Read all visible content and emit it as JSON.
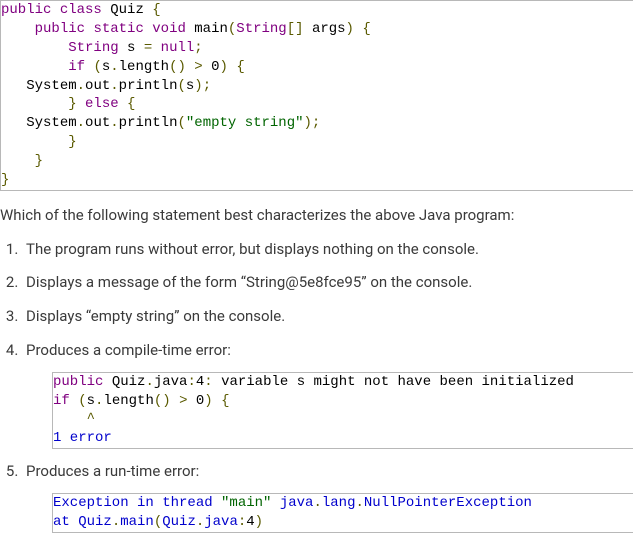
{
  "code_main": {
    "l1": "public class Quiz {",
    "l2": "    public static void main(String[] args) {",
    "l3": "        String s = null;",
    "l4": "        if (s.length() > 0) {",
    "l5": "   System.out.println(s);",
    "l6": "        } else {",
    "l7": "   System.out.println(\"empty string\");",
    "l8": "        }",
    "l9": "    }",
    "l10": "}"
  },
  "question": "Which of the following statement best characterizes the above Java program:",
  "options": {
    "opt1": "The program runs without error, but displays nothing on the console.",
    "opt2": "Displays a message of the form “String@5e8fce95” on the console.",
    "opt3": "Displays “empty string” on the console.",
    "opt4": "Produces a compile-time error:",
    "opt5": "Produces a run-time error:"
  },
  "code_opt4": {
    "l1": "public Quiz.java:4: variable s might not have been initialized",
    "l2": "if (s.length() > 0) {",
    "l3": "    ^",
    "l4": "1 error"
  },
  "code_opt5": {
    "l1": "Exception in thread \"main\" java.lang.NullPointerException",
    "l2": "at Quiz.main(Quiz.java:4)"
  }
}
